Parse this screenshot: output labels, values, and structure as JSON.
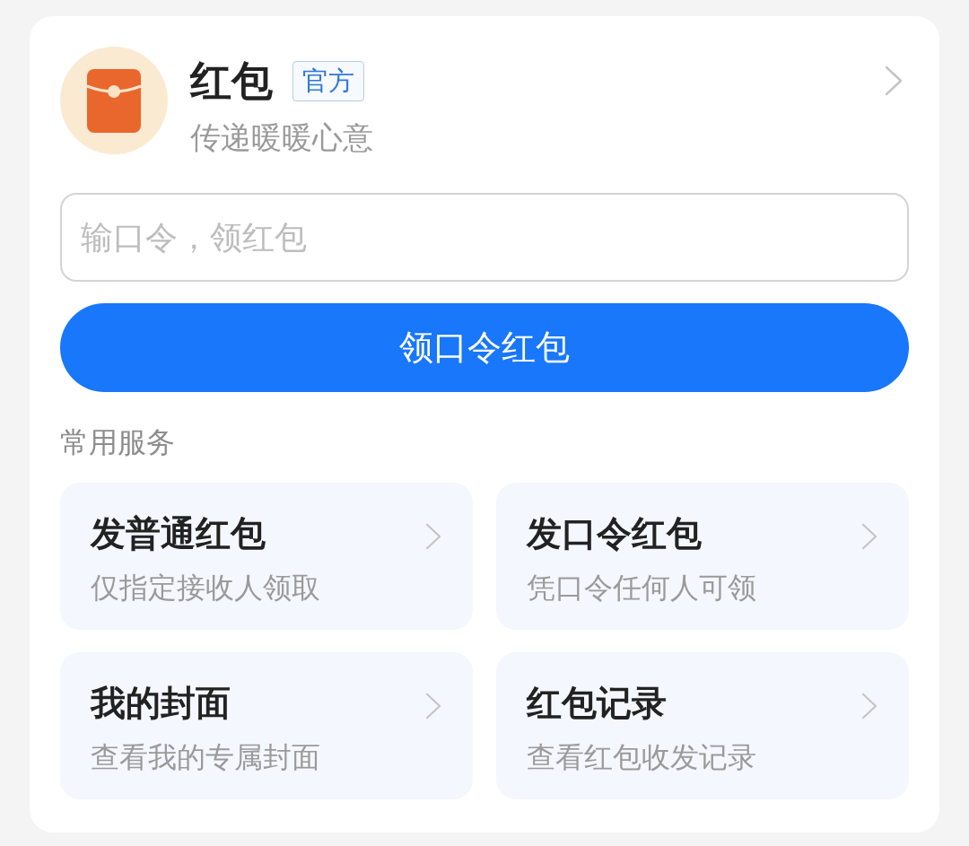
{
  "header": {
    "title": "红包",
    "badge": "官方",
    "subtitle": "传递暖暖心意"
  },
  "code_input": {
    "placeholder": "输口令，领红包"
  },
  "claim_button": {
    "label": "领口令红包"
  },
  "services": {
    "heading": "常用服务",
    "items": [
      {
        "title": "发普通红包",
        "description": "仅指定接收人领取"
      },
      {
        "title": "发口令红包",
        "description": "凭口令任何人可领"
      },
      {
        "title": "我的封面",
        "description": "查看我的专属封面"
      },
      {
        "title": "红包记录",
        "description": "查看红包收发记录"
      }
    ]
  }
}
